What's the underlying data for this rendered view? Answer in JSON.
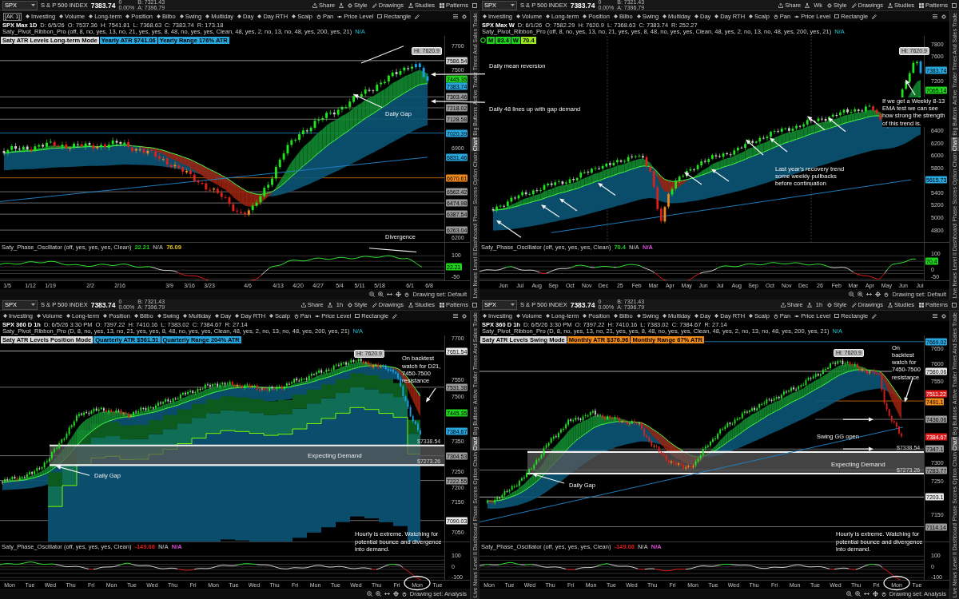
{
  "panels": [
    {
      "header": {
        "symbol": "SPX",
        "instrument": "S & P 500 INDEX",
        "price": "7383.74",
        "net_change": "0",
        "change": "0.00%",
        "bid": "B: 7321.43",
        "ask": "A: 7396.79",
        "buttons": [
          "Share",
          "Style",
          "Drawings",
          "Studies",
          "Patterns"
        ]
      },
      "tag": "[AK 1]",
      "toolbar": [
        {
          "label": "Investing",
          "kind": "preset"
        },
        {
          "label": "Volume",
          "kind": "preset"
        },
        {
          "label": "Long-term",
          "kind": "preset"
        },
        {
          "label": "Position",
          "kind": "preset"
        },
        {
          "label": "Bilbo",
          "kind": "preset"
        },
        {
          "label": "Swing",
          "kind": "preset"
        },
        {
          "label": "Multiday",
          "kind": "preset"
        },
        {
          "label": "Day",
          "kind": "preset"
        },
        {
          "label": "Day RTH",
          "kind": "preset"
        },
        {
          "label": "Scalp",
          "kind": "preset"
        },
        {
          "label": "Pan",
          "kind": "pan"
        },
        {
          "label": "Price Level",
          "kind": "level"
        },
        {
          "label": "Rectangle",
          "kind": "rect"
        }
      ],
      "info": {
        "title": "SPX Max 1D",
        "fields": [
          "D: 6/5/26",
          "O: 7537.36",
          "H: 7541.81",
          "L: 7368.63",
          "C: 7383.74",
          "R: 173.18"
        ],
        "study": "Saty_Pivot_Ribbon_Pro (off, 8, no, yes, 13, no, 21, yes, yes, 8, 48, no, yes, yes, Clean, 48, yes, 2, no, 13, no, 48, yes, 200, yes, 21)",
        "status": "N/A"
      },
      "badges": [
        {
          "text": "Saty ATR Levels Long-term Mode",
          "color": "#d9d9d9"
        },
        {
          "text": "Yearly ATR $741.06",
          "color": "#29a8e0"
        },
        {
          "text": "Yearly Range 176% ATR",
          "color": "#29a8e0"
        }
      ],
      "hi_label": "Hi: 7620.9",
      "price_axis": [
        {
          "text": "7700",
          "kind": "tick"
        },
        {
          "text": "7586.54",
          "kind": "marker",
          "color": "#d0d0d0"
        },
        {
          "text": "7500",
          "kind": "tick"
        },
        {
          "text": "7445.35",
          "kind": "marker",
          "color": "#1ed21e"
        },
        {
          "text": "7383.74",
          "kind": "marker",
          "color": "#29a8e0"
        },
        {
          "text": "7303.46",
          "kind": "marker",
          "color": "#9a9a9a"
        },
        {
          "text": "7218.02",
          "kind": "marker",
          "color": "#9a9a9a"
        },
        {
          "text": "7128.58",
          "kind": "marker",
          "color": "#9a9a9a"
        },
        {
          "text": "7020.39",
          "kind": "marker",
          "color": "#29a8e0"
        },
        {
          "text": "6900",
          "kind": "tick"
        },
        {
          "text": "6831.46",
          "kind": "marker",
          "color": "#29a8e0"
        },
        {
          "text": "6670.61",
          "kind": "marker",
          "color": "#f08a1c"
        },
        {
          "text": "6562.42",
          "kind": "marker",
          "color": "#9a9a9a"
        },
        {
          "text": "6474.98",
          "kind": "marker",
          "color": "#9a9a9a"
        },
        {
          "text": "6387.54",
          "kind": "marker",
          "color": "#9a9a9a"
        },
        {
          "text": "6263.04",
          "kind": "marker",
          "color": "#9a9a9a"
        },
        {
          "text": "6200",
          "kind": "tick"
        }
      ],
      "annotations": [
        {
          "text": "Daily mean reversion",
          "kind": "note"
        },
        {
          "text": "Daily 48 lines up with gap demand",
          "kind": "note"
        },
        {
          "text": "Daily Gap",
          "kind": "note"
        },
        {
          "text": "Divergence",
          "kind": "note"
        }
      ],
      "oscillator": {
        "label": "Saty_Phase_Oscillator (off, yes, yes, yes, Clean)",
        "readings": [
          {
            "text": "22.21",
            "color": "#1ed21e"
          },
          {
            "text": "N/A",
            "color": "#9a9a9a"
          },
          {
            "text": "76.09",
            "color": "#e6c81e"
          }
        ],
        "axis": [
          {
            "text": "100",
            "kind": "tick"
          },
          {
            "text": "22.21",
            "kind": "marker",
            "color": "#1ed21e"
          },
          {
            "text": "-50",
            "kind": "tick"
          }
        ]
      },
      "time_axis": [
        "1/5",
        "1/12",
        "1/19",
        "2/2",
        "2/16",
        "3/9",
        "3/16",
        "3/23",
        "4/6",
        "4/13",
        "4/20",
        "4/27",
        "5/4",
        "5/11",
        "5/18",
        "6/1",
        "6/8"
      ],
      "drawing_set": "Drawing set: Default",
      "sidebar": [
        {
          "label": "Trade",
          "selected": false
        },
        {
          "label": "Times And Sales",
          "selected": false
        },
        {
          "label": "Active Trader",
          "selected": false
        },
        {
          "label": "Big Buttons",
          "selected": false
        },
        {
          "label": "Chart",
          "selected": true
        },
        {
          "label": "Option Chain",
          "selected": false
        },
        {
          "label": "Phase Scores",
          "selected": false
        },
        {
          "label": "Dashboard",
          "selected": false
        },
        {
          "label": "Level II",
          "selected": false
        },
        {
          "label": "Live News",
          "selected": false
        }
      ]
    },
    {
      "header": {
        "symbol": "SPX",
        "instrument": "S & P 500 INDEX",
        "price": "7383.74",
        "net_change": "0",
        "change": "0.00%",
        "bid": "B: 7321.43",
        "ask": "A: 7396.79",
        "timeframe": "Wk",
        "buttons": [
          "Share",
          "Style",
          "Drawings",
          "Studies",
          "Patterns"
        ]
      },
      "toolbar": [
        {
          "label": "Investing",
          "kind": "preset"
        },
        {
          "label": "Volume",
          "kind": "preset"
        },
        {
          "label": "Long-term",
          "kind": "preset"
        },
        {
          "label": "Position",
          "kind": "preset"
        },
        {
          "label": "Bilbo",
          "kind": "preset"
        },
        {
          "label": "Swing",
          "kind": "preset"
        },
        {
          "label": "Multiday",
          "kind": "preset"
        },
        {
          "label": "Day",
          "kind": "preset"
        },
        {
          "label": "Day RTH",
          "kind": "preset"
        },
        {
          "label": "Scalp",
          "kind": "preset"
        },
        {
          "label": "Pan",
          "kind": "pan"
        },
        {
          "label": "Price Level",
          "kind": "level"
        },
        {
          "label": "Rectangle",
          "kind": "rect"
        }
      ],
      "info": {
        "title": "SPX Max W",
        "fields": [
          "D: 6/1/26",
          "O: 7582.29",
          "H: 7620.9",
          "L: 7368.63",
          "C: 7383.74",
          "R: 252.27"
        ],
        "study": "Saty_Pivot_Ribbon_Pro (off, 8, no, yes, 13, no, 21, yes, yes, 8, 48, no, yes, yes, Clean, 48, yes, 2, no, 13, no, 48, yes, 200, yes, 21)",
        "status": "N/A"
      },
      "badges": [
        {
          "text": "M",
          "color": "#1ed21e"
        },
        {
          "text": "83.4",
          "color": "#1ed21e"
        },
        {
          "text": "W",
          "color": "#1ed21e"
        },
        {
          "text": "70.4",
          "color": "#9be61e"
        }
      ],
      "hi_label": "Hi: 7620.9",
      "price_axis": [
        {
          "text": "7800",
          "kind": "tick"
        },
        {
          "text": "7600",
          "kind": "tick"
        },
        {
          "text": "7383.74",
          "kind": "marker",
          "color": "#29a8e0"
        },
        {
          "text": "7200",
          "kind": "tick"
        },
        {
          "text": "7065.14",
          "kind": "marker",
          "color": "#1ed21e"
        },
        {
          "text": "6400",
          "kind": "tick"
        },
        {
          "text": "6200",
          "kind": "tick"
        },
        {
          "text": "6000",
          "kind": "tick"
        },
        {
          "text": "5800",
          "kind": "tick"
        },
        {
          "text": "5615.73",
          "kind": "marker",
          "color": "#29a8e0"
        },
        {
          "text": "5400",
          "kind": "tick"
        },
        {
          "text": "5200",
          "kind": "tick"
        },
        {
          "text": "5000",
          "kind": "tick"
        },
        {
          "text": "4800",
          "kind": "tick"
        }
      ],
      "annotations": [
        {
          "text": "If we get a Weekly 8-13 EMA test we can see how strong the strength of this trend is.",
          "kind": "note"
        },
        {
          "text": "Last year's recovery trend some weekly pullbacks before continuation",
          "kind": "note"
        }
      ],
      "oscillator": {
        "label": "Saty_Phase_Oscillator (off, yes, yes, yes, Clean)",
        "readings": [
          {
            "text": "70.4",
            "color": "#1ed21e"
          },
          {
            "text": "N/A",
            "color": "#9a9a9a"
          },
          {
            "text": "N/A",
            "color": "#d24bd2"
          }
        ],
        "axis": [
          {
            "text": "100",
            "kind": "tick"
          },
          {
            "text": "70.4",
            "kind": "marker",
            "color": "#1ed21e"
          },
          {
            "text": "0",
            "kind": "tick"
          },
          {
            "text": "-50",
            "kind": "tick"
          }
        ]
      },
      "time_axis": [
        "Jun",
        "Jul",
        "Aug",
        "Sep",
        "Oct",
        "Nov",
        "Dec",
        "25",
        "Feb",
        "Mar",
        "Apr",
        "May",
        "Jun",
        "Jul",
        "Aug",
        "Sep",
        "Oct",
        "Nov",
        "Dec",
        "26",
        "Feb",
        "Mar",
        "Apr",
        "May",
        "Jun",
        "Jul"
      ],
      "drawing_set": "Drawing set: Default",
      "sidebar": [
        {
          "label": "Trade",
          "selected": false
        },
        {
          "label": "Times And Sales",
          "selected": false
        },
        {
          "label": "Active Trader",
          "selected": false
        },
        {
          "label": "Big Buttons",
          "selected": false
        },
        {
          "label": "Chart",
          "selected": true
        },
        {
          "label": "Option Chain",
          "selected": false
        },
        {
          "label": "Phase Scores",
          "selected": false
        },
        {
          "label": "Dashboard",
          "selected": false
        },
        {
          "label": "Level II",
          "selected": false
        },
        {
          "label": "Live News",
          "selected": false
        }
      ]
    },
    {
      "header": {
        "symbol": "SPX",
        "instrument": "S & P 500 INDEX",
        "price": "7383.74",
        "net_change": "0",
        "change": "0.00%",
        "bid": "B: 7321.43",
        "ask": "A: 7396.79",
        "timeframe": "1h",
        "buttons": [
          "Share",
          "Style",
          "Drawings",
          "Studies",
          "Patterns"
        ]
      },
      "toolbar": [
        {
          "label": "Investing",
          "kind": "preset"
        },
        {
          "label": "Volume",
          "kind": "preset"
        },
        {
          "label": "Long-term",
          "kind": "preset"
        },
        {
          "label": "Position",
          "kind": "preset"
        },
        {
          "label": "Bilbo",
          "kind": "preset"
        },
        {
          "label": "Swing",
          "kind": "preset"
        },
        {
          "label": "Multiday",
          "kind": "preset"
        },
        {
          "label": "Day",
          "kind": "preset"
        },
        {
          "label": "Day RTH",
          "kind": "preset"
        },
        {
          "label": "Scalp",
          "kind": "preset"
        },
        {
          "label": "Pan",
          "kind": "pan"
        },
        {
          "label": "Price Level",
          "kind": "level"
        },
        {
          "label": "Rectangle",
          "kind": "rect"
        }
      ],
      "info": {
        "title": "SPX 360 D 1h",
        "fields": [
          "D: 6/5/26 3:30 PM",
          "O: 7397.22",
          "H: 7410.16",
          "L: 7383.02",
          "C: 7384.67",
          "R: 27.14"
        ],
        "study": "Saty_Pivot_Ribbon_Pro (D, 8, no, yes, 13, no, 21, yes, yes, 8, 48, no, yes, yes, Clean, 48, yes, 2, no, 13, no, 48, yes, 200, yes, 21)",
        "status": "N/A"
      },
      "badges": [
        {
          "text": "Saty ATR Levels Position Mode",
          "color": "#d9d9d9"
        },
        {
          "text": "Quarterly ATR $561.51",
          "color": "#29a8e0"
        },
        {
          "text": "Quarterly Range 204% ATR",
          "color": "#29a8e0"
        }
      ],
      "hi_label": "Hi: 7620.9",
      "price_axis": [
        {
          "text": "7700",
          "kind": "tick"
        },
        {
          "text": "7651.54",
          "kind": "marker",
          "color": "#e8e8e8"
        },
        {
          "text": "7550",
          "kind": "tick"
        },
        {
          "text": "7531.38",
          "kind": "marker",
          "color": "#9a9a9a"
        },
        {
          "text": "7500",
          "kind": "tick"
        },
        {
          "text": "7445.35",
          "kind": "marker",
          "color": "#1ed21e"
        },
        {
          "text": "7384.67",
          "kind": "marker",
          "color": "#29a8e0"
        },
        {
          "text": "7350",
          "kind": "tick"
        },
        {
          "text": "7304.53",
          "kind": "marker",
          "color": "#9a9a9a"
        },
        {
          "text": "7250",
          "kind": "tick"
        },
        {
          "text": "7222.55",
          "kind": "marker",
          "color": "#9a9a9a"
        },
        {
          "text": "7200",
          "kind": "tick"
        },
        {
          "text": "7150",
          "kind": "tick"
        },
        {
          "text": "7090.03",
          "kind": "marker",
          "color": "#e8e8e8"
        },
        {
          "text": "7050",
          "kind": "tick"
        }
      ],
      "annotations": [
        {
          "text": "On backtest watch for D21, 7450-7500 resistance",
          "kind": "note"
        },
        {
          "text": "$7338.54",
          "kind": "price"
        },
        {
          "text": "Expecting Demand",
          "kind": "zone"
        },
        {
          "text": "$7273.26",
          "kind": "price"
        },
        {
          "text": "Daily Gap",
          "kind": "note"
        },
        {
          "text": "Hourly is extreme. Watching for potential bounce and divergence into demand.",
          "kind": "note"
        }
      ],
      "oscillator": {
        "label": "Saty_Phase_Oscillator (off, yes, yes, yes, Clean)",
        "readings": [
          {
            "text": "-149.08",
            "color": "#e01b1b"
          },
          {
            "text": "N/A",
            "color": "#9a9a9a"
          },
          {
            "text": "N/A",
            "color": "#d24bd2"
          }
        ],
        "axis": [
          {
            "text": "100",
            "kind": "tick"
          },
          {
            "text": "0",
            "kind": "tick"
          },
          {
            "text": "-100",
            "kind": "tick"
          }
        ]
      },
      "time_axis": [
        "Mon",
        "Tue",
        "Wed",
        "Thu",
        "Fri",
        "Mon",
        "Tue",
        "Wed",
        "Thu",
        "Fri",
        "Mon",
        "Tue",
        "Wed",
        "Thu",
        "Fri",
        "Mon",
        "Tue",
        "Wed",
        "Thu",
        "Fri",
        "Mon",
        "Tue"
      ],
      "drawing_set": "Drawing set: Analysis",
      "sidebar": [
        {
          "label": "Trade",
          "selected": false
        },
        {
          "label": "Times And Sales",
          "selected": false
        },
        {
          "label": "Active Trader",
          "selected": false
        },
        {
          "label": "Big Buttons",
          "selected": false
        },
        {
          "label": "Chart",
          "selected": true
        },
        {
          "label": "Option Chain",
          "selected": false
        },
        {
          "label": "Phase Scores",
          "selected": false
        },
        {
          "label": "Dashboard",
          "selected": false
        },
        {
          "label": "Level II",
          "selected": false
        },
        {
          "label": "Live News",
          "selected": false
        }
      ]
    },
    {
      "header": {
        "symbol": "SPX",
        "instrument": "S & P 500 INDEX",
        "price": "7383.74",
        "net_change": "0",
        "change": "0.00%",
        "bid": "B: 7321.43",
        "ask": "A: 7396.79",
        "timeframe": "1h",
        "buttons": [
          "Share",
          "Style",
          "Drawings",
          "Studies",
          "Patterns"
        ]
      },
      "toolbar": [
        {
          "label": "Investing",
          "kind": "preset"
        },
        {
          "label": "Volume",
          "kind": "preset"
        },
        {
          "label": "Long-term",
          "kind": "preset"
        },
        {
          "label": "Position",
          "kind": "preset"
        },
        {
          "label": "Bilbo",
          "kind": "preset"
        },
        {
          "label": "Swing",
          "kind": "preset"
        },
        {
          "label": "Multiday",
          "kind": "preset"
        },
        {
          "label": "Day",
          "kind": "preset"
        },
        {
          "label": "Day RTH",
          "kind": "preset"
        },
        {
          "label": "Scalp",
          "kind": "preset"
        },
        {
          "label": "Pan",
          "kind": "pan"
        },
        {
          "label": "Price Level",
          "kind": "level"
        },
        {
          "label": "Rectangle",
          "kind": "rect"
        }
      ],
      "info": {
        "title": "SPX 360 D 1h",
        "fields": [
          "D: 6/5/26 3:30 PM",
          "O: 7397.22",
          "H: 7410.16",
          "L: 7383.02",
          "C: 7384.67",
          "R: 27.14"
        ],
        "study": "Saty_Pivot_Ribbon_Pro (D, 8, no, yes, 13, no, 21, yes, yes, 8, 48, no, yes, yes, Clean, 48, yes, 2, no, 13, no, 48, yes, 200, yes, 21)",
        "status": "N/A"
      },
      "badges": [
        {
          "text": "Saty ATR Levels Swing Mode",
          "color": "#d9d9d9"
        },
        {
          "text": "Monthly ATR $376.96",
          "color": "#f08a1c"
        },
        {
          "text": "Monthly Range 67% ATR",
          "color": "#f08a1c"
        }
      ],
      "hi_label": "Hi: 7620.9",
      "price_axis": [
        {
          "text": "7669.02",
          "kind": "marker",
          "color": "#29a8e0"
        },
        {
          "text": "7650",
          "kind": "tick"
        },
        {
          "text": "7600",
          "kind": "tick"
        },
        {
          "text": "7580.06",
          "kind": "marker",
          "color": "#e8e8e8"
        },
        {
          "text": "7550",
          "kind": "tick"
        },
        {
          "text": "7511.22",
          "kind": "marker",
          "color": "#e01b1b"
        },
        {
          "text": "7491.1",
          "kind": "marker",
          "color": "#f08a1c"
        },
        {
          "text": "7436.06",
          "kind": "marker",
          "color": "#9a9a9a"
        },
        {
          "text": "7384.67",
          "kind": "marker",
          "color": "#e01b1b"
        },
        {
          "text": "7347.1",
          "kind": "marker",
          "color": "#9a9a9a"
        },
        {
          "text": "7300",
          "kind": "tick"
        },
        {
          "text": "7283.77",
          "kind": "marker",
          "color": "#9a9a9a"
        },
        {
          "text": "7250",
          "kind": "tick"
        },
        {
          "text": "7203.1",
          "kind": "marker",
          "color": "#e8e8e8"
        },
        {
          "text": "7150",
          "kind": "tick"
        },
        {
          "text": "7114.14",
          "kind": "marker",
          "color": "#9a9a9a"
        }
      ],
      "annotations": [
        {
          "text": "On backtest watch for 7450-7500 resistance",
          "kind": "note"
        },
        {
          "text": "Swing GG open",
          "kind": "note"
        },
        {
          "text": "$7338.54",
          "kind": "price"
        },
        {
          "text": "Expecting Demand",
          "kind": "zone"
        },
        {
          "text": "$7273.26",
          "kind": "price"
        },
        {
          "text": "Daily Gap",
          "kind": "note"
        },
        {
          "text": "Hourly is extreme. Watching for potential bounce and divergence into demand.",
          "kind": "note"
        }
      ],
      "oscillator": {
        "label": "Saty_Phase_Oscillator (off, yes, yes, yes, Clean)",
        "readings": [
          {
            "text": "-149.08",
            "color": "#e01b1b"
          },
          {
            "text": "N/A",
            "color": "#9a9a9a"
          },
          {
            "text": "N/A",
            "color": "#d24bd2"
          }
        ],
        "axis": [
          {
            "text": "100",
            "kind": "tick"
          },
          {
            "text": "0",
            "kind": "tick"
          },
          {
            "text": "-100",
            "kind": "tick"
          }
        ]
      },
      "time_axis": [
        "Mon",
        "Tue",
        "Wed",
        "Thu",
        "Fri",
        "Mon",
        "Tue",
        "Wed",
        "Thu",
        "Fri",
        "Mon",
        "Tue",
        "Wed",
        "Thu",
        "Fri",
        "Mon",
        "Tue",
        "Wed",
        "Thu",
        "Fri",
        "Mon",
        "Tue"
      ],
      "drawing_set": "Drawing set: Analysis",
      "sidebar": [
        {
          "label": "Trade",
          "selected": false
        },
        {
          "label": "Times And Sales",
          "selected": false
        },
        {
          "label": "Active Trader",
          "selected": false
        },
        {
          "label": "Big Buttons",
          "selected": false
        },
        {
          "label": "Chart",
          "selected": true
        },
        {
          "label": "Option Chain",
          "selected": false
        },
        {
          "label": "Phase Scores",
          "selected": false
        },
        {
          "label": "Dashboard",
          "selected": false
        },
        {
          "label": "Level II",
          "selected": false
        },
        {
          "label": "Live News",
          "selected": false
        }
      ]
    }
  ]
}
